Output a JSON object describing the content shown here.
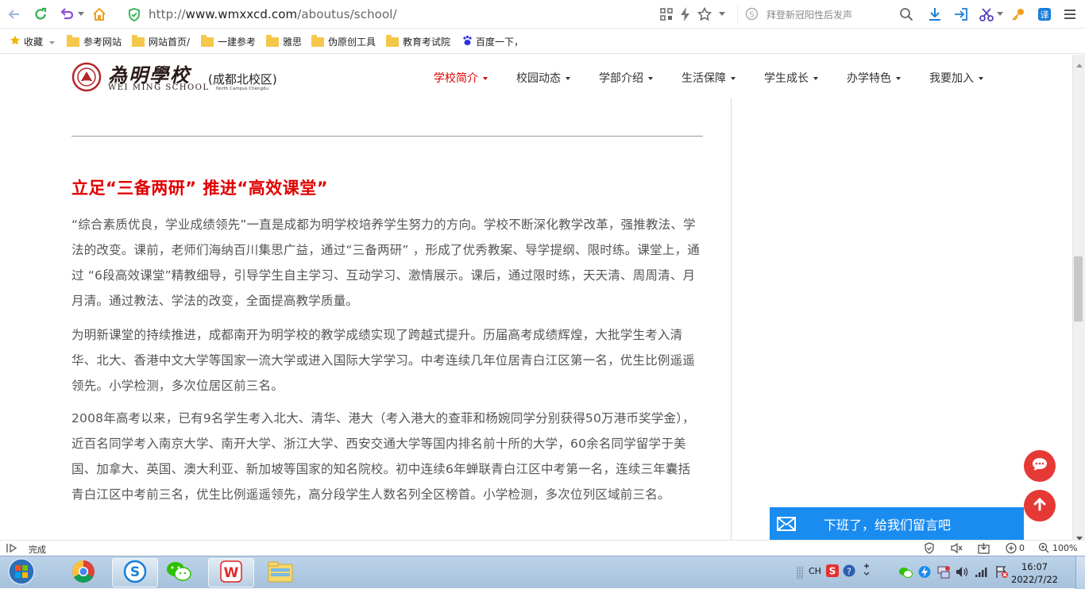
{
  "browser": {
    "url_prefix": "http://",
    "url_domain": "www.wmxxcd.com",
    "url_path": "/aboutus/school/",
    "search_placeholder": "拜登新冠阳性后发声"
  },
  "bookmarks": {
    "favorites_label": "收藏",
    "items": [
      {
        "label": "参考网站"
      },
      {
        "label": "网站首页/"
      },
      {
        "label": "一建参考"
      },
      {
        "label": "雅思"
      },
      {
        "label": "伪原创工具"
      },
      {
        "label": "教育考试院"
      },
      {
        "label": "百度一下，"
      }
    ]
  },
  "site": {
    "logo_cn": "為明學校",
    "logo_en": "WEI MING SCHOOL",
    "campus": "成都北校区",
    "campus_en": "North Campus Chengdu",
    "nav": [
      {
        "label": "学校简介",
        "active": true
      },
      {
        "label": "校园动态",
        "active": false
      },
      {
        "label": "学部介绍",
        "active": false
      },
      {
        "label": "生活保障",
        "active": false
      },
      {
        "label": "学生成长",
        "active": false
      },
      {
        "label": "办学特色",
        "active": false
      },
      {
        "label": "我要加入",
        "active": false
      }
    ]
  },
  "article": {
    "heading": "立足“三备两研” 推进“高效课堂”",
    "paragraphs": [
      "“综合素质优良，学业成绩领先”一直是成都为明学校培养学生努力的方向。学校不断深化教学改革，强推教法、学法的改变。课前，老师们海纳百川集思广益，通过“三备两研” ，形成了优秀教案、导学提纲、限时练。课堂上，通过 “6段高效课堂”精教细导，引导学生自主学习、互动学习、激情展示。课后，通过限时练，天天清、周周清、月月清。通过教法、学法的改变，全面提高教学质量。",
      "为明新课堂的持续推进，成都南开为明学校的教学成绩实现了跨越式提升。历届高考成绩辉煌，大批学生考入清华、北大、香港中文大学等国家一流大学或进入国际大学学习。中考连续几年位居青白江区第一名，优生比例遥遥领先。小学检测，多次位居区前三名。",
      "2008年高考以来，已有9名学生考入北大、清华、港大（考入港大的查菲和杨婉同学分别获得50万港币奖学金），近百名同学考入南京大学、南开大学、浙江大学、西安交通大学等国内排名前十所的大学，60余名同学留学于美国、加拿大、英国、澳大利亚、新加坡等国家的知名院校。初中连续6年蝉联青白江区中考第一名，连续三年囊括青白江区中考前三名，优生比例遥遥领先，高分段学生人数名列全区榜首。小学检测，多次位列区域前三名。"
    ]
  },
  "widgets": {
    "message_bar": "下班了，给我们留言吧"
  },
  "statusbar": {
    "status": "完成",
    "count": "0",
    "zoom": "100%"
  },
  "taskbar": {
    "lang": "CH",
    "time": "16:07",
    "date": "2022/7/22"
  },
  "colors": {
    "accent_red": "#e00000",
    "message_blue": "#1a8cf0",
    "fab_red": "#e53935"
  }
}
